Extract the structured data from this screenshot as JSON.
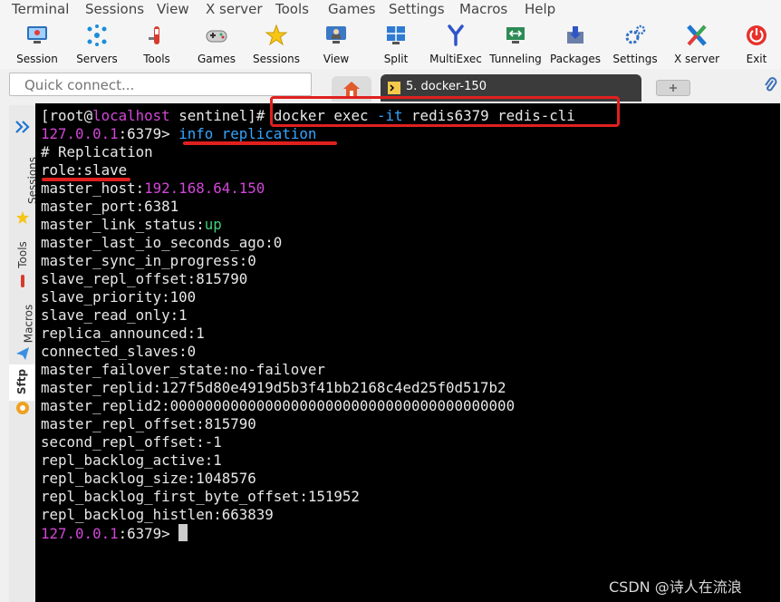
{
  "menu": [
    "Terminal",
    "Sessions",
    "View",
    "X server",
    "Tools",
    "Games",
    "Settings",
    "Macros",
    "Help"
  ],
  "toolbar": [
    {
      "label": "Session",
      "icon": "session-monitor-icon"
    },
    {
      "label": "Servers",
      "icon": "servers-network-icon"
    },
    {
      "label": "Tools",
      "icon": "tools-icon"
    },
    {
      "label": "Games",
      "icon": "gamepad-icon"
    },
    {
      "label": "Sessions",
      "icon": "star-icon"
    },
    {
      "label": "View",
      "icon": "view-user-icon"
    },
    {
      "label": "Split",
      "icon": "split-screen-icon"
    },
    {
      "label": "MultiExec",
      "icon": "multiexec-fork-icon"
    },
    {
      "label": "Tunneling",
      "icon": "tunneling-icon"
    },
    {
      "label": "Packages",
      "icon": "packages-icon"
    },
    {
      "label": "Settings",
      "icon": "settings-gears-icon"
    },
    {
      "label": "X server",
      "icon": "x-server-icon"
    },
    {
      "label": "Exit",
      "icon": "power-icon"
    }
  ],
  "side_fragment": "S",
  "quick_connect": {
    "placeholder": "Quick connect..."
  },
  "tabs": {
    "active_label": "5. docker-150"
  },
  "left_panel": {
    "sessions": "Sessions",
    "tools": "Tools",
    "macros": "Macros",
    "sftp": "Sftp"
  },
  "terminal": {
    "prompt_user": "root",
    "prompt_host": "localhost",
    "prompt_dir": " sentinel",
    "prompt_end": "]# ",
    "cmd1_a": "docker exec ",
    "cmd1_flag": "-it",
    "cmd1_b": " redis6379 redis-cli",
    "redis_ip": "127.0.0.1",
    "redis_port": ":6379> ",
    "cmd2": "info replication",
    "info_lines": [
      "# Replication",
      "role:slave",
      "master_host:",
      "master_port:6381",
      "master_link_status:",
      "master_last_io_seconds_ago:0",
      "master_sync_in_progress:0",
      "slave_repl_offset:815790",
      "slave_priority:100",
      "slave_read_only:1",
      "replica_announced:1",
      "connected_slaves:0",
      "master_failover_state:no-failover",
      "master_replid:127f5d80e4919d5b3f41bb2168c4ed25f0d517b2",
      "master_replid2:0000000000000000000000000000000000000000",
      "master_repl_offset:815790",
      "second_repl_offset:-1",
      "repl_backlog_active:1",
      "repl_backlog_size:1048576",
      "repl_backlog_first_byte_offset:151952",
      "repl_backlog_histlen:663839"
    ],
    "master_host_value": "192.168.64.150",
    "link_status_value": "up"
  },
  "watermark": "CSDN @诗人在流浪",
  "colors": {
    "highlight": "#e0201f",
    "prompt_magenta": "#d346d9",
    "flag_blue": "#36a5ff",
    "status_green": "#3fd07a"
  }
}
